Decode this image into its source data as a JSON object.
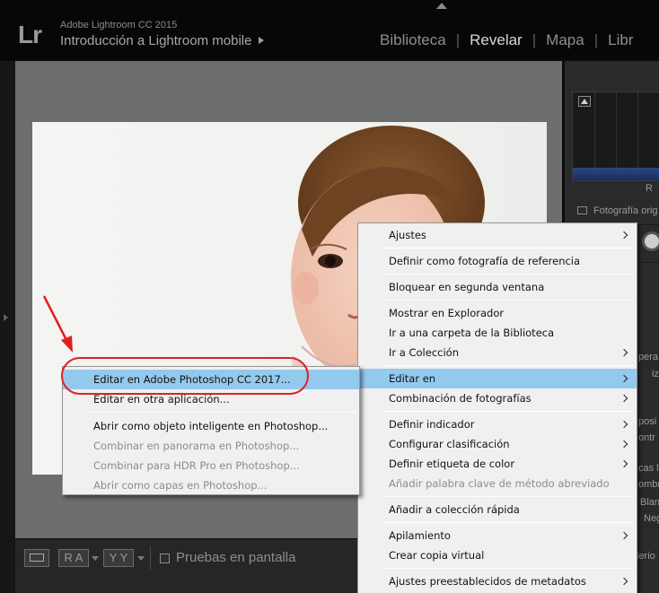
{
  "app": {
    "name": "Adobe Lightroom CC 2015",
    "logo": "Lr",
    "catalog": "Introducción a Lightroom mobile"
  },
  "modules": [
    {
      "label": "Biblioteca",
      "active": false
    },
    {
      "label": "Revelar",
      "active": true
    },
    {
      "label": "Mapa",
      "active": false
    },
    {
      "label": "Libr",
      "active": false
    }
  ],
  "right_panel": {
    "histogram_channel": "R",
    "original_photo_label": "Fotografía orig",
    "fragments": [
      "pera",
      "iz",
      "posi",
      "ontr",
      "cas lu",
      "ombr",
      "Blan",
      "Neg",
      "ierio"
    ]
  },
  "toolbar": {
    "ra_label": "R A",
    "yy_label": "Y Y",
    "softproof_label": "Pruebas en pantalla"
  },
  "main_menu": {
    "items": [
      {
        "label": "Ajustes",
        "submenu": true,
        "disabled": false,
        "highlight": false
      },
      {
        "sep": true
      },
      {
        "label": "Definir como fotografía de referencia",
        "submenu": false,
        "disabled": false,
        "highlight": false
      },
      {
        "sep": true
      },
      {
        "label": "Bloquear en segunda ventana",
        "submenu": false,
        "disabled": false,
        "highlight": false
      },
      {
        "sep": true
      },
      {
        "label": "Mostrar en Explorador",
        "submenu": false,
        "disabled": false,
        "highlight": false
      },
      {
        "label": "Ir a una carpeta de la Biblioteca",
        "submenu": false,
        "disabled": false,
        "highlight": false
      },
      {
        "label": "Ir a Colección",
        "submenu": true,
        "disabled": false,
        "highlight": false
      },
      {
        "sep": true
      },
      {
        "label": "Editar en",
        "submenu": true,
        "disabled": false,
        "highlight": true
      },
      {
        "label": "Combinación de fotografías",
        "submenu": true,
        "disabled": false,
        "highlight": false
      },
      {
        "sep": true
      },
      {
        "label": "Definir indicador",
        "submenu": true,
        "disabled": false,
        "highlight": false
      },
      {
        "label": "Configurar clasificación",
        "submenu": true,
        "disabled": false,
        "highlight": false
      },
      {
        "label": "Definir etiqueta de color",
        "submenu": true,
        "disabled": false,
        "highlight": false
      },
      {
        "label": "Añadir palabra clave de método abreviado",
        "submenu": false,
        "disabled": true,
        "highlight": false
      },
      {
        "sep": true
      },
      {
        "label": "Añadir a colección rápida",
        "submenu": false,
        "disabled": false,
        "highlight": false
      },
      {
        "sep": true
      },
      {
        "label": "Apilamiento",
        "submenu": true,
        "disabled": false,
        "highlight": false
      },
      {
        "label": "Crear copia virtual",
        "submenu": false,
        "disabled": false,
        "highlight": false
      },
      {
        "sep": true
      },
      {
        "label": "Ajustes preestablecidos de metadatos",
        "submenu": true,
        "disabled": false,
        "highlight": false
      }
    ]
  },
  "sub_menu": {
    "items": [
      {
        "label": "Editar en Adobe Photoshop CC 2017...",
        "disabled": false,
        "highlight": true
      },
      {
        "label": "Editar en otra aplicación...",
        "disabled": false,
        "highlight": false
      },
      {
        "sep": true
      },
      {
        "label": "Abrir como objeto inteligente en Photoshop...",
        "disabled": false,
        "highlight": false
      },
      {
        "label": "Combinar en panorama en Photoshop...",
        "disabled": true,
        "highlight": false
      },
      {
        "label": "Combinar para HDR Pro en Photoshop...",
        "disabled": true,
        "highlight": false
      },
      {
        "label": "Abrir como capas en Photoshop...",
        "disabled": true,
        "highlight": false
      }
    ]
  },
  "colors": {
    "menu_highlight": "#94c9ee",
    "annotation": "#e02020"
  }
}
